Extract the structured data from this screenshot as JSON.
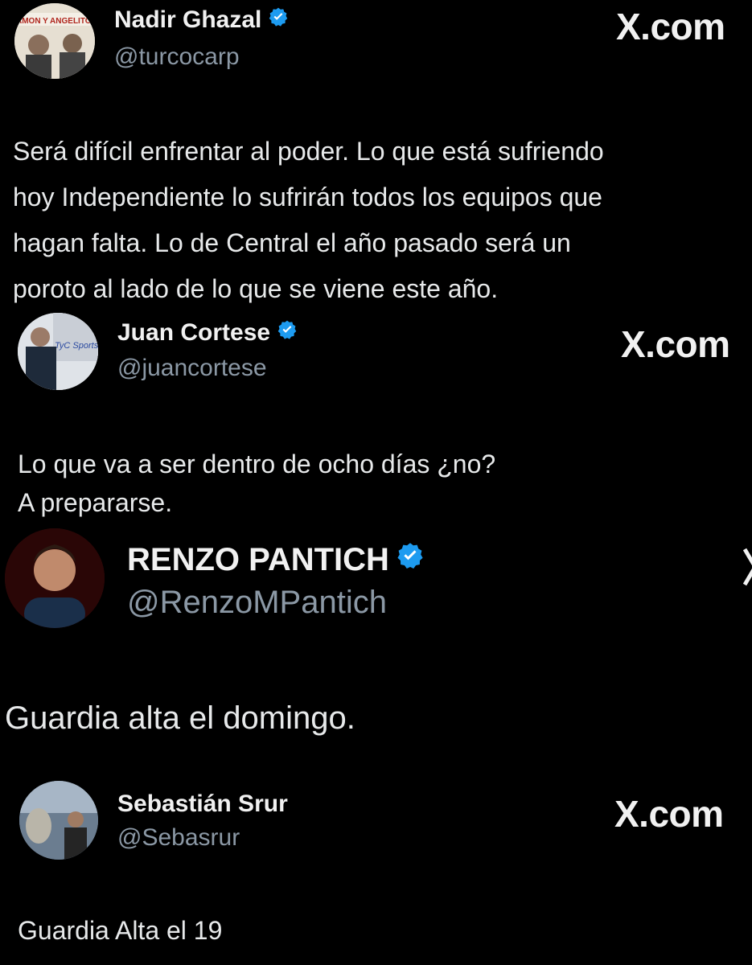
{
  "site_label": "X.com",
  "tweets": [
    {
      "name": "Nadir Ghazal",
      "handle": "@turcocarp",
      "verified": true,
      "avatar_text": "AMON Y ANGELITO",
      "text": "Será difícil enfrentar al poder. Lo que está sufriendo\nhoy Independiente lo sufrirán todos los equipos que\nhagan falta. Lo de Central el año pasado será un\nporoto al lado de lo que se viene este año."
    },
    {
      "name": "Juan Cortese",
      "handle": "@juancortese",
      "verified": true,
      "avatar_text": "TyC Sports",
      "text": "Lo que va a ser dentro de ocho días ¿no?\nA prepararse."
    },
    {
      "name": "RENZO PANTICH",
      "handle": "@RenzoMPantich",
      "verified": true,
      "text": "Guardia alta el domingo."
    },
    {
      "name": "Sebastián Srur",
      "handle": "@Sebasrur",
      "verified": false,
      "text": "Guardia Alta el 19"
    }
  ],
  "colors": {
    "background": "#000000",
    "text": "#e7e9ea",
    "handle": "#8b98a5",
    "verified": "#1d9bf0"
  },
  "icons": [
    "verified-badge-icon",
    "x-logo-icon"
  ]
}
